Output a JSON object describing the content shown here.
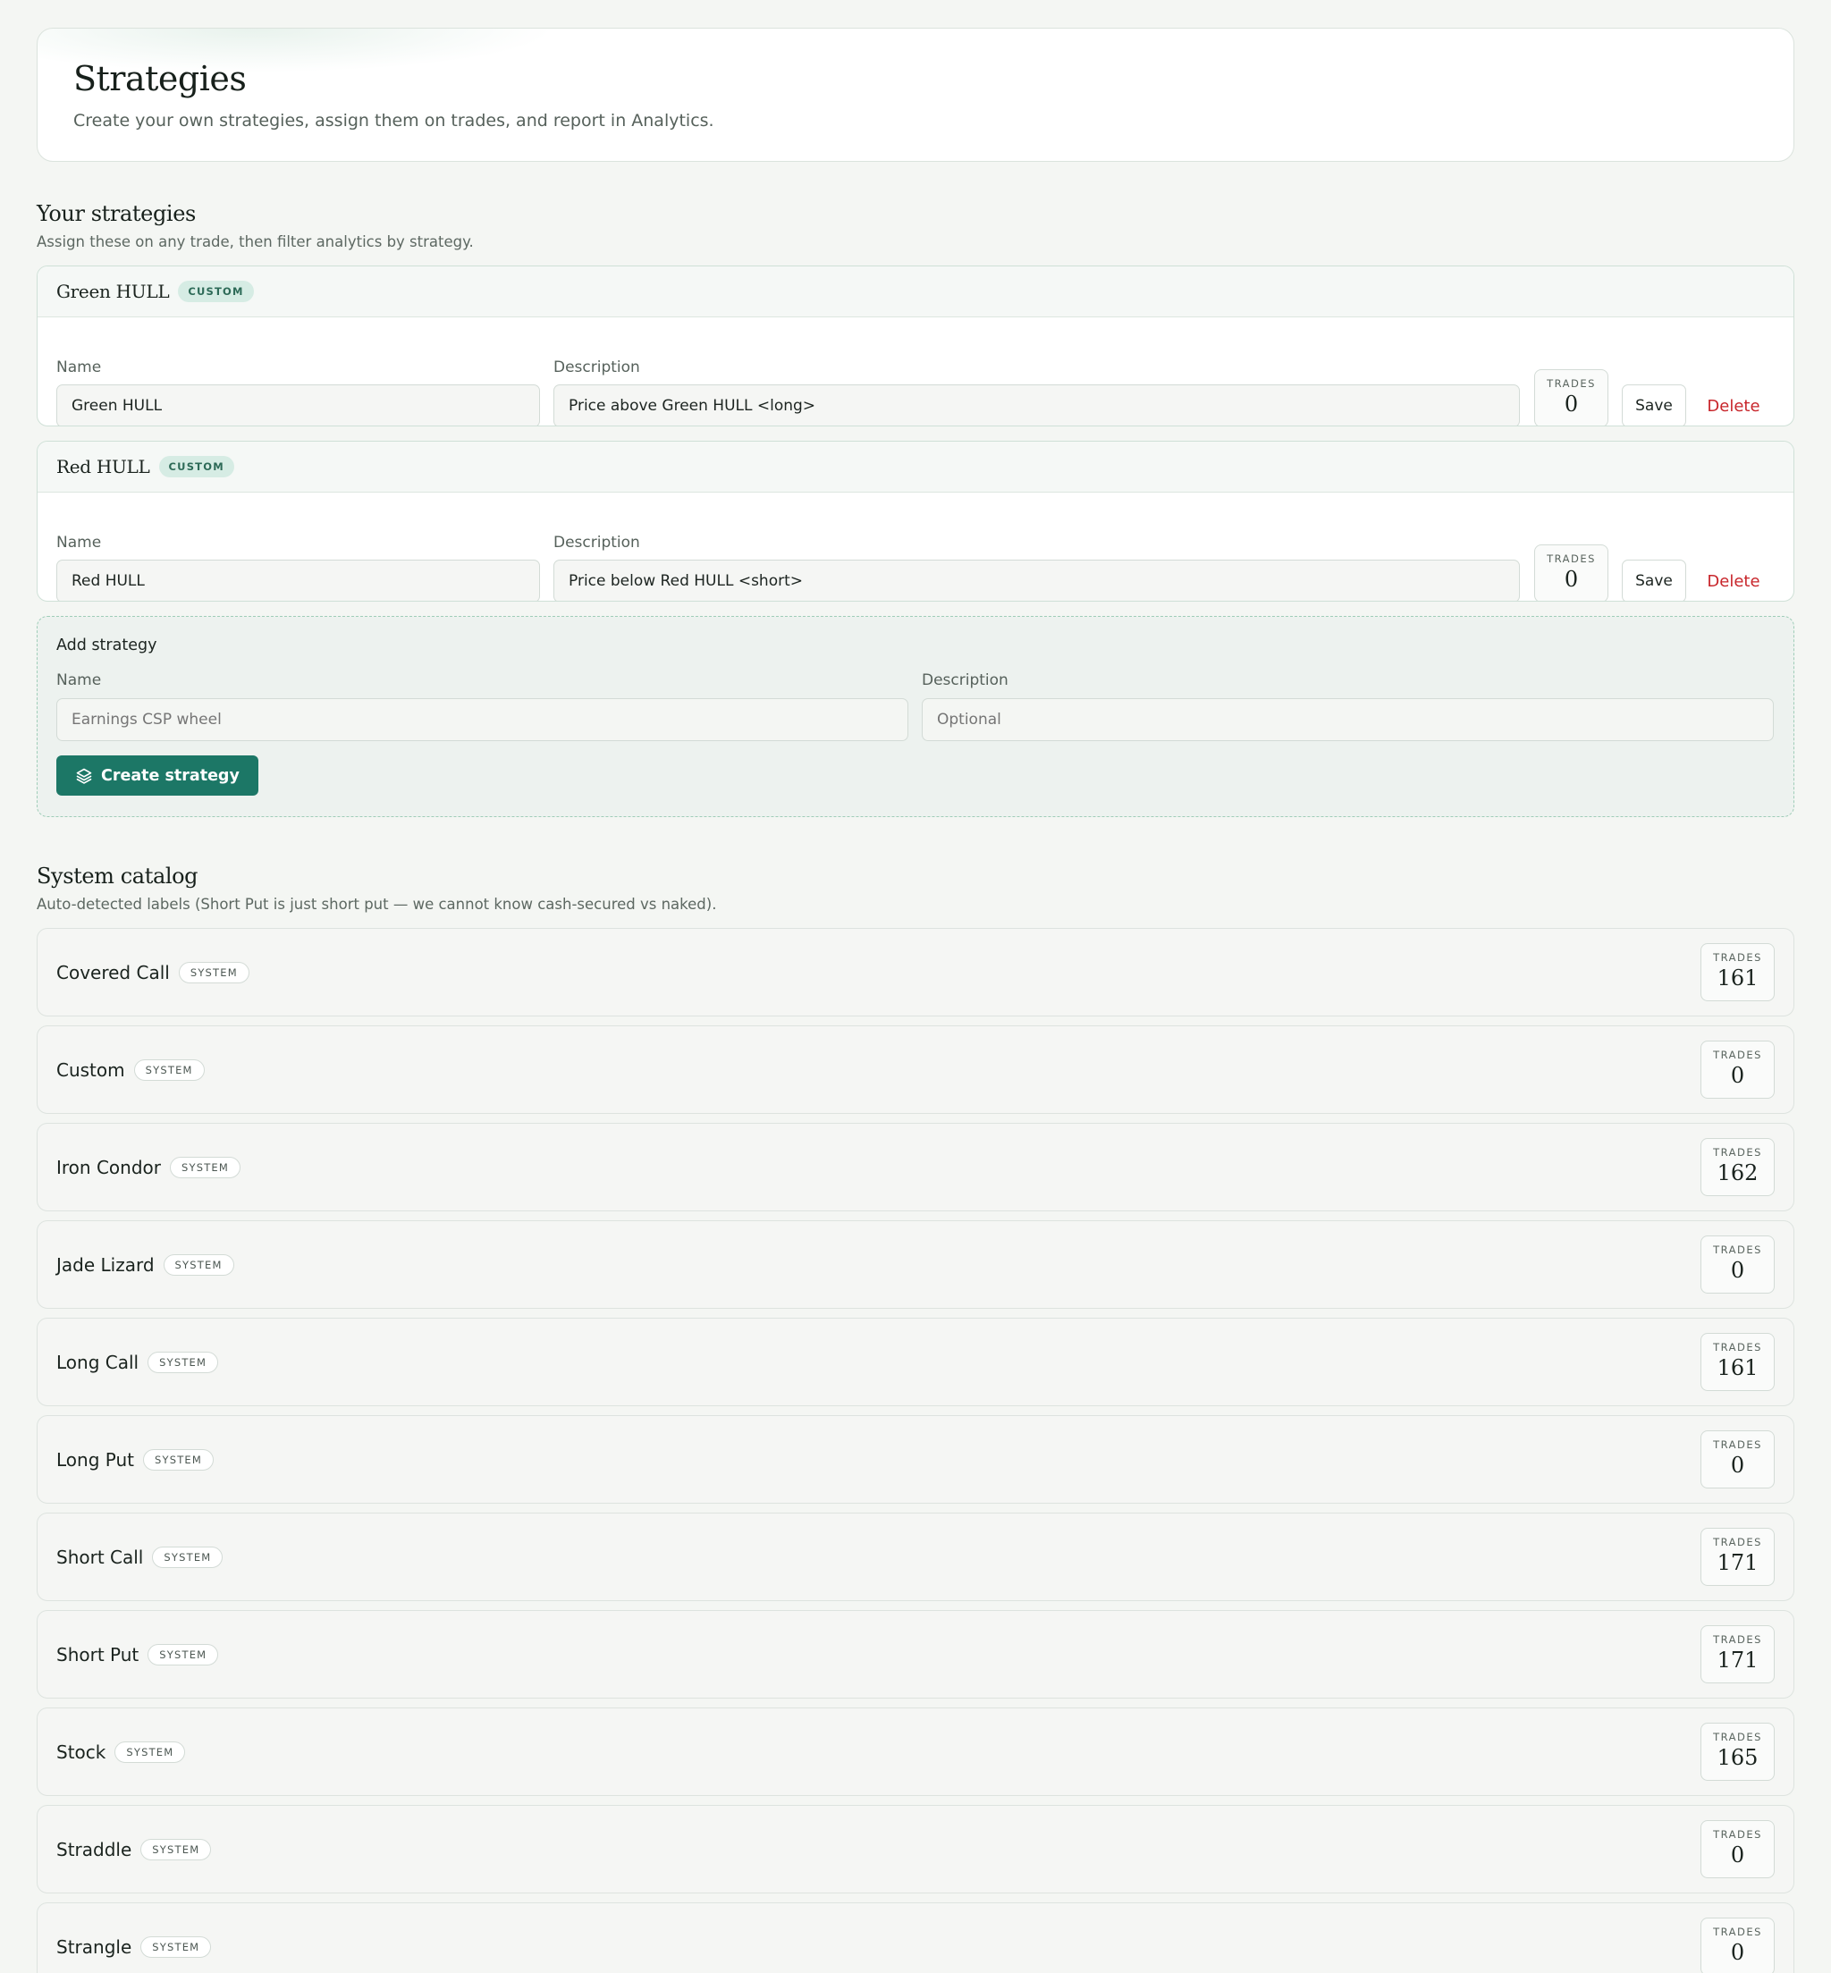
{
  "header": {
    "title": "Strategies",
    "subtitle": "Create your own strategies, assign them on trades, and report in Analytics."
  },
  "your_strategies": {
    "title": "Your strategies",
    "subtitle": "Assign these on any trade, then filter analytics by strategy.",
    "name_label": "Name",
    "description_label": "Description",
    "trades_label": "TRADES",
    "save_label": "Save",
    "delete_label": "Delete",
    "items": [
      {
        "title": "Green HULL",
        "badge": "CUSTOM",
        "name": "Green HULL",
        "description": "Price above Green HULL <long>",
        "trades": "0"
      },
      {
        "title": "Red HULL",
        "badge": "CUSTOM",
        "name": "Red HULL",
        "description": "Price below Red HULL <short>",
        "trades": "0"
      }
    ]
  },
  "add_strategy": {
    "title": "Add strategy",
    "name_label": "Name",
    "name_placeholder": "Earnings CSP wheel",
    "description_label": "Description",
    "description_placeholder": "Optional",
    "create_label": "Create strategy",
    "create_icon": "layers-icon"
  },
  "system_catalog": {
    "title": "System catalog",
    "subtitle": "Auto-detected labels (Short Put is just short put — we cannot know cash-secured vs naked).",
    "badge": "SYSTEM",
    "trades_label": "TRADES",
    "items": [
      {
        "name": "Covered Call",
        "trades": "161"
      },
      {
        "name": "Custom",
        "trades": "0"
      },
      {
        "name": "Iron Condor",
        "trades": "162"
      },
      {
        "name": "Jade Lizard",
        "trades": "0"
      },
      {
        "name": "Long Call",
        "trades": "161"
      },
      {
        "name": "Long Put",
        "trades": "0"
      },
      {
        "name": "Short Call",
        "trades": "171"
      },
      {
        "name": "Short Put",
        "trades": "171"
      },
      {
        "name": "Stock",
        "trades": "165"
      },
      {
        "name": "Straddle",
        "trades": "0"
      },
      {
        "name": "Strangle",
        "trades": "0"
      }
    ]
  },
  "colors": {
    "accent": "#1c7766",
    "danger": "#c8262b",
    "badge_custom_bg": "#d6ece4",
    "page_bg": "#f4f6f3"
  }
}
